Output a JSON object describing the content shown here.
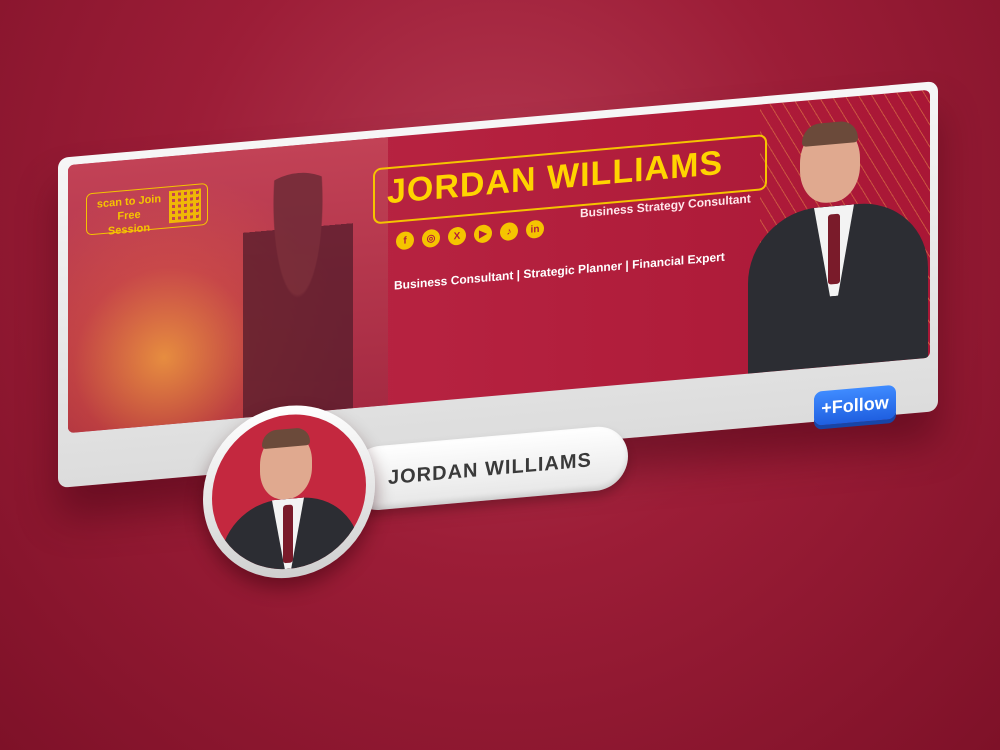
{
  "banner": {
    "qr_label": "scan to Join\nFree Session",
    "name": "JORDAN WILLIAMS",
    "subtitle": "Business Strategy Consultant",
    "roles": "Business Consultant | Strategic Planner | Financial Expert",
    "socials": [
      {
        "icon": "facebook-icon",
        "glyph": "f"
      },
      {
        "icon": "instagram-icon",
        "glyph": "◎"
      },
      {
        "icon": "x-icon",
        "glyph": "X"
      },
      {
        "icon": "youtube-icon",
        "glyph": "▶"
      },
      {
        "icon": "tiktok-icon",
        "glyph": "♪"
      },
      {
        "icon": "linkedin-icon",
        "glyph": "in"
      }
    ]
  },
  "profile": {
    "name": "JORDAN WILLIAMS",
    "follow_label": "+Follow"
  },
  "colors": {
    "background": "#9c1d37",
    "banner": "#b01d3b",
    "accent_yellow": "#f5c400",
    "follow_blue": "#1f5fe0"
  }
}
